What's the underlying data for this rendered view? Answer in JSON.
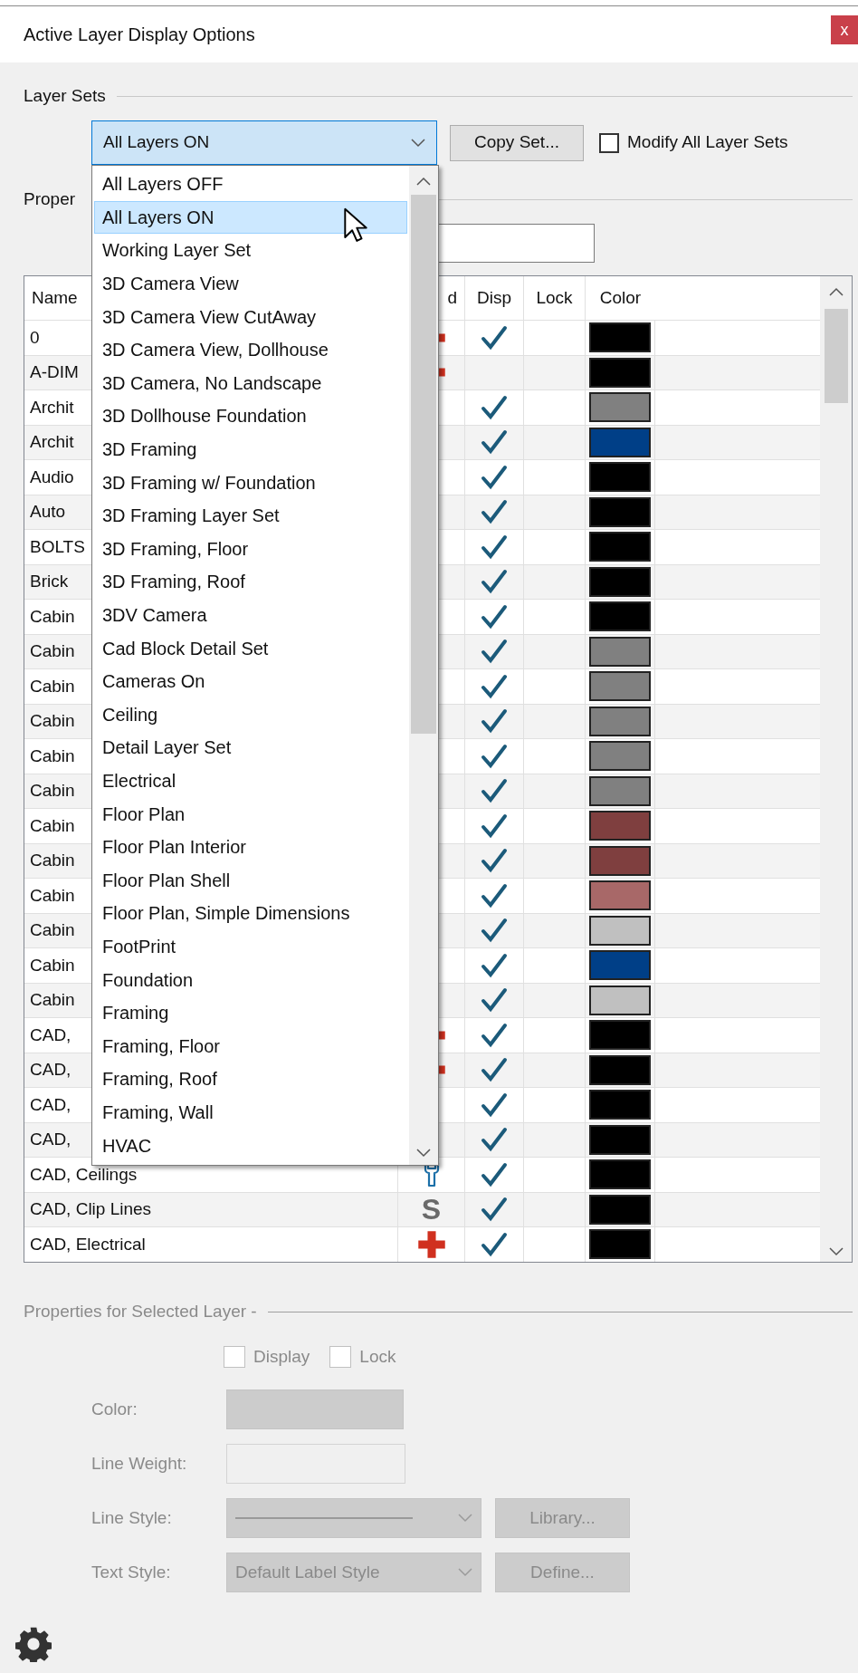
{
  "window": {
    "title": "Active Layer Display Options",
    "close": "x"
  },
  "layer_sets": {
    "heading": "Layer Sets",
    "combo": {
      "value": "All Layers ON",
      "expanded": true
    },
    "copy_button": "Copy Set...",
    "modify_all": {
      "label": "Modify All Layer Sets",
      "checked": false
    },
    "dropdown": {
      "items": [
        {
          "label": "All Layers OFF",
          "selected": false
        },
        {
          "label": "All Layers ON",
          "selected": true
        },
        {
          "label": "Working Layer Set",
          "selected": false
        },
        {
          "label": "3D Camera View",
          "selected": false
        },
        {
          "label": "3D Camera View CutAway",
          "selected": false
        },
        {
          "label": "3D Camera View, Dollhouse",
          "selected": false
        },
        {
          "label": "3D Camera, No Landscape",
          "selected": false
        },
        {
          "label": "3D Dollhouse Foundation",
          "selected": false
        },
        {
          "label": "3D Framing",
          "selected": false
        },
        {
          "label": "3D Framing  w/ Foundation",
          "selected": false
        },
        {
          "label": "3D Framing Layer Set",
          "selected": false
        },
        {
          "label": "3D Framing, Floor",
          "selected": false
        },
        {
          "label": "3D Framing, Roof",
          "selected": false
        },
        {
          "label": "3DV Camera",
          "selected": false
        },
        {
          "label": "Cad Block Detail Set",
          "selected": false
        },
        {
          "label": "Cameras On",
          "selected": false
        },
        {
          "label": "Ceiling",
          "selected": false
        },
        {
          "label": "Detail Layer Set",
          "selected": false
        },
        {
          "label": "Electrical",
          "selected": false
        },
        {
          "label": "Floor Plan",
          "selected": false
        },
        {
          "label": "Floor Plan Interior",
          "selected": false
        },
        {
          "label": "Floor Plan Shell",
          "selected": false
        },
        {
          "label": "Floor Plan, Simple Dimensions",
          "selected": false
        },
        {
          "label": "FootPrint",
          "selected": false
        },
        {
          "label": "Foundation",
          "selected": false
        },
        {
          "label": "Framing",
          "selected": false
        },
        {
          "label": "Framing, Floor",
          "selected": false
        },
        {
          "label": "Framing, Roof",
          "selected": false
        },
        {
          "label": "Framing, Wall",
          "selected": false
        },
        {
          "label": "HVAC",
          "selected": false
        }
      ]
    }
  },
  "properties": {
    "heading": "Proper"
  },
  "table": {
    "columns": [
      "Name",
      "d",
      "Disp",
      "Lock",
      "Color"
    ],
    "rows": [
      {
        "name": "0",
        "kind": "plus",
        "disp": true,
        "color": "#000000"
      },
      {
        "name": "A-DIM",
        "kind": "plus",
        "disp": false,
        "color": "#000000"
      },
      {
        "name": "Archit",
        "disp": true,
        "color": "#808080"
      },
      {
        "name": "Archit",
        "disp": true,
        "color": "#003f87"
      },
      {
        "name": "Audio",
        "disp": true,
        "color": "#000000"
      },
      {
        "name": "Auto",
        "disp": true,
        "color": "#000000"
      },
      {
        "name": "BOLTS",
        "disp": true,
        "color": "#000000"
      },
      {
        "name": "Brick",
        "disp": true,
        "color": "#000000"
      },
      {
        "name": "Cabin",
        "disp": true,
        "color": "#000000"
      },
      {
        "name": "Cabin",
        "disp": true,
        "color": "#808080"
      },
      {
        "name": "Cabin",
        "disp": true,
        "color": "#808080"
      },
      {
        "name": "Cabin",
        "disp": true,
        "color": "#808080"
      },
      {
        "name": "Cabin",
        "disp": true,
        "color": "#808080"
      },
      {
        "name": "Cabin",
        "disp": true,
        "color": "#808080"
      },
      {
        "name": "Cabin",
        "disp": true,
        "color": "#7f3f3f"
      },
      {
        "name": "Cabin",
        "disp": true,
        "color": "#7f3f3f"
      },
      {
        "name": "Cabin",
        "disp": true,
        "color": "#a86868"
      },
      {
        "name": "Cabin",
        "disp": true,
        "color": "#c0c0c0"
      },
      {
        "name": "Cabin",
        "disp": true,
        "color": "#003f87"
      },
      {
        "name": "Cabin",
        "disp": true,
        "color": "#c0c0c0"
      },
      {
        "name": "CAD,",
        "kind": "plus",
        "disp": true,
        "color": "#000000"
      },
      {
        "name": "CAD,",
        "kind": "plus",
        "disp": true,
        "color": "#000000"
      },
      {
        "name": "CAD,",
        "disp": true,
        "color": "#000000"
      },
      {
        "name": "CAD,",
        "disp": true,
        "color": "#000000"
      },
      {
        "name": "CAD, Ceilings",
        "kind": "wrench",
        "disp": true,
        "color": "#000000"
      },
      {
        "name": "CAD, Clip Lines",
        "kind": "letter",
        "symbol": "S",
        "disp": true,
        "color": "#000000"
      },
      {
        "name": "CAD, Electrical",
        "kind": "plus",
        "disp": true,
        "color": "#000000"
      }
    ]
  },
  "selected_layer": {
    "heading": "Properties for Selected Layer -",
    "disabled": true,
    "display": {
      "label": "Display",
      "checked": false
    },
    "lock": {
      "label": "Lock",
      "checked": false
    },
    "fields": [
      {
        "kind": "color",
        "label": "Color:"
      },
      {
        "kind": "input",
        "label": "Line Weight:"
      },
      {
        "kind": "line-select",
        "label": "Line Style:",
        "button": "Library..."
      },
      {
        "kind": "select",
        "label": "Text Style:",
        "value": "Default Label Style",
        "button": "Define..."
      }
    ]
  }
}
